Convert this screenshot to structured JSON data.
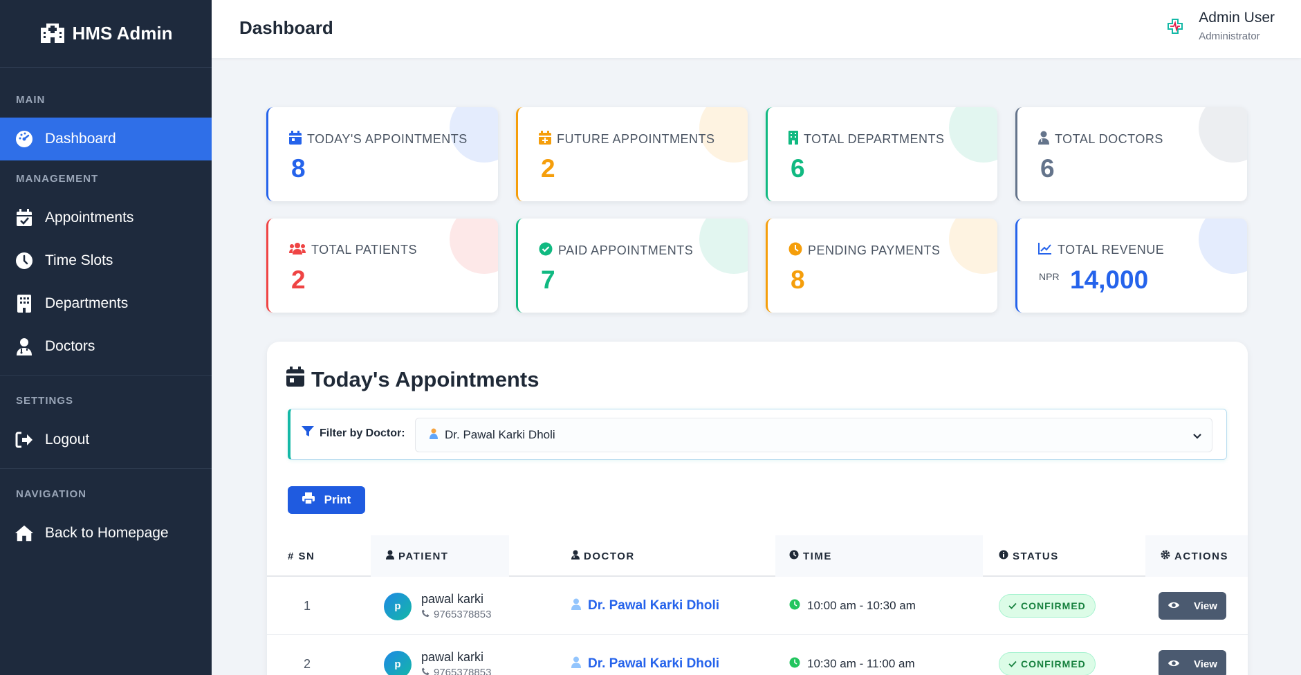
{
  "sidebar": {
    "brand": "HMS Admin",
    "sections": {
      "main": "MAIN",
      "management": "MANAGEMENT",
      "settings": "SETTINGS",
      "navigation": "NAVIGATION"
    },
    "items": {
      "dashboard": "Dashboard",
      "appointments": "Appointments",
      "time_slots": "Time Slots",
      "departments": "Departments",
      "doctors": "Doctors",
      "logout": "Logout",
      "homepage": "Back to Homepage"
    }
  },
  "header": {
    "title": "Dashboard",
    "user_name": "Admin User",
    "user_role": "Administrator"
  },
  "stats": {
    "todays_appointments": {
      "label": "TODAY'S APPOINTMENTS",
      "value": "8",
      "color": "#2563eb"
    },
    "future_appointments": {
      "label": "FUTURE APPOINTMENTS",
      "value": "2",
      "color": "#f59e0b"
    },
    "total_departments": {
      "label": "TOTAL DEPARTMENTS",
      "value": "6",
      "color": "#10b981"
    },
    "total_doctors": {
      "label": "TOTAL DOCTORS",
      "value": "6",
      "color": "#64748b"
    },
    "total_patients": {
      "label": "TOTAL PATIENTS",
      "value": "2",
      "color": "#ef4444"
    },
    "paid_appointments": {
      "label": "PAID APPOINTMENTS",
      "value": "7",
      "color": "#10b981"
    },
    "pending_payments": {
      "label": "PENDING PAYMENTS",
      "value": "8",
      "color": "#f59e0b"
    },
    "total_revenue": {
      "label": "TOTAL REVENUE",
      "prefix": "NPR",
      "value": "14,000",
      "color": "#2563eb"
    }
  },
  "panel": {
    "title": "Today's Appointments",
    "filter_label": "Filter by Doctor:",
    "filter_value": "Dr. Pawal Karki Dholi",
    "print_label": "Print"
  },
  "table": {
    "headers": {
      "sn": "# SN",
      "patient": "PATIENT",
      "doctor": "DOCTOR",
      "time": "TIME",
      "status": "STATUS",
      "actions": "ACTIONS"
    },
    "rows": [
      {
        "sn": "1",
        "initial": "p",
        "patient": "pawal karki",
        "phone": "9765378853",
        "doctor": "Dr. Pawal Karki Dholi",
        "time": "10:00 am - 10:30 am",
        "status": "CONFIRMED",
        "action": "View"
      },
      {
        "sn": "2",
        "initial": "p",
        "patient": "pawal karki",
        "phone": "9765378853",
        "doctor": "Dr. Pawal Karki Dholi",
        "time": "10:30 am - 11:00 am",
        "status": "CONFIRMED",
        "action": "View"
      }
    ]
  }
}
